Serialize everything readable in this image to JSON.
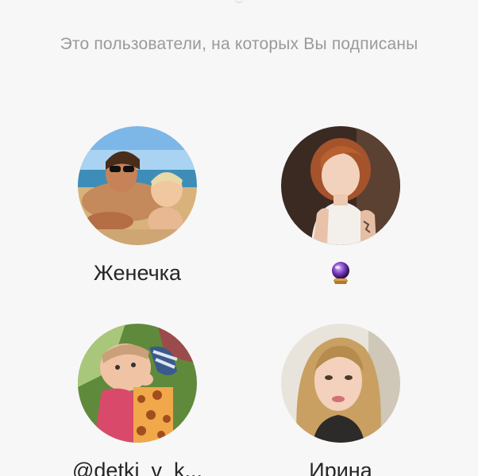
{
  "subtitle": "Это пользователи, на которых Вы подписаны",
  "users": [
    {
      "name": "Женечка",
      "avatar": "beach-family-photo"
    },
    {
      "name": "",
      "avatar": "red-hair-woman-photo",
      "name_icon": "crystal-ball-icon"
    },
    {
      "name": "@detki_v_k...",
      "avatar": "baby-photo"
    },
    {
      "name": "Ирина",
      "avatar": "blonde-woman-photo"
    }
  ],
  "colors": {
    "background": "#f7f7f7",
    "subtitle": "#9a9a9a",
    "name": "#262626"
  }
}
